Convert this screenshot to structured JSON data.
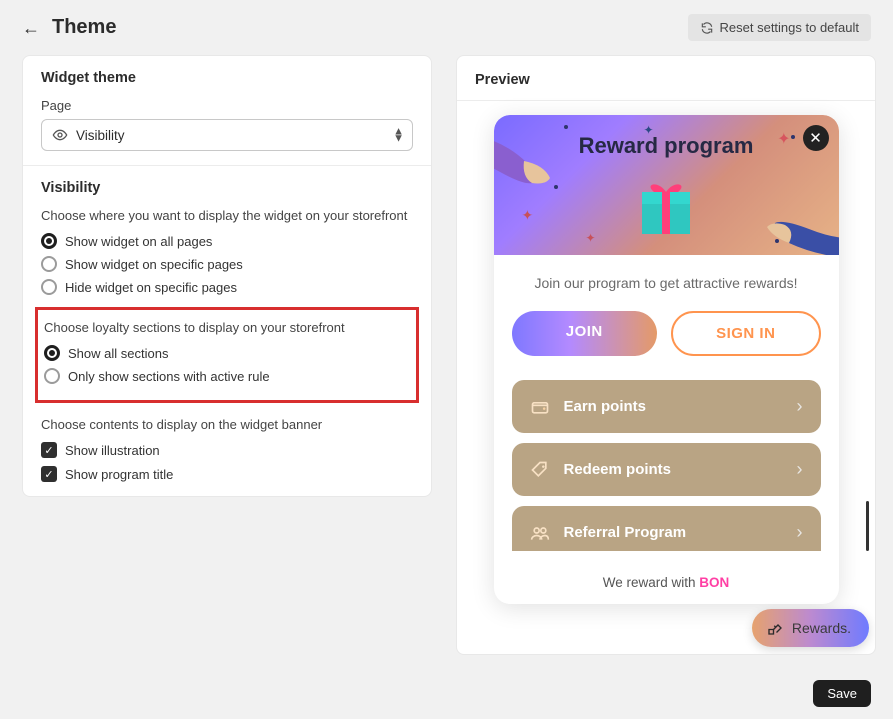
{
  "header": {
    "title": "Theme",
    "reset_label": "Reset settings to default"
  },
  "left": {
    "widget_theme_title": "Widget theme",
    "page_label": "Page",
    "page_select_value": "Visibility",
    "visibility_title": "Visibility",
    "display_helper": "Choose where you want to display the widget on your storefront",
    "display_options": [
      "Show widget on all pages",
      "Show widget on specific pages",
      "Hide widget on specific pages"
    ],
    "display_selected_index": 0,
    "sections_helper": "Choose loyalty sections to display on your storefront",
    "sections_options": [
      "Show all sections",
      "Only show sections with active rule"
    ],
    "sections_selected_index": 0,
    "banner_helper": "Choose contents to display on the widget banner",
    "checkbox_illustration": "Show illustration",
    "checkbox_program_title": "Show program title",
    "checkbox_illustration_checked": true,
    "checkbox_program_title_checked": true
  },
  "preview": {
    "header": "Preview",
    "hero_title": "Reward program",
    "subtitle": "Join our program to get attractive rewards!",
    "join_label": "JOIN",
    "signin_label": "SIGN IN",
    "actions": [
      {
        "label": "Earn points",
        "icon": "wallet-icon"
      },
      {
        "label": "Redeem points",
        "icon": "tag-icon"
      },
      {
        "label": "Referral Program",
        "icon": "people-icon"
      }
    ],
    "footer_prefix": "We reward with ",
    "footer_brand": "BON",
    "floating_label": "Rewards."
  },
  "footer": {
    "save_label": "Save"
  }
}
